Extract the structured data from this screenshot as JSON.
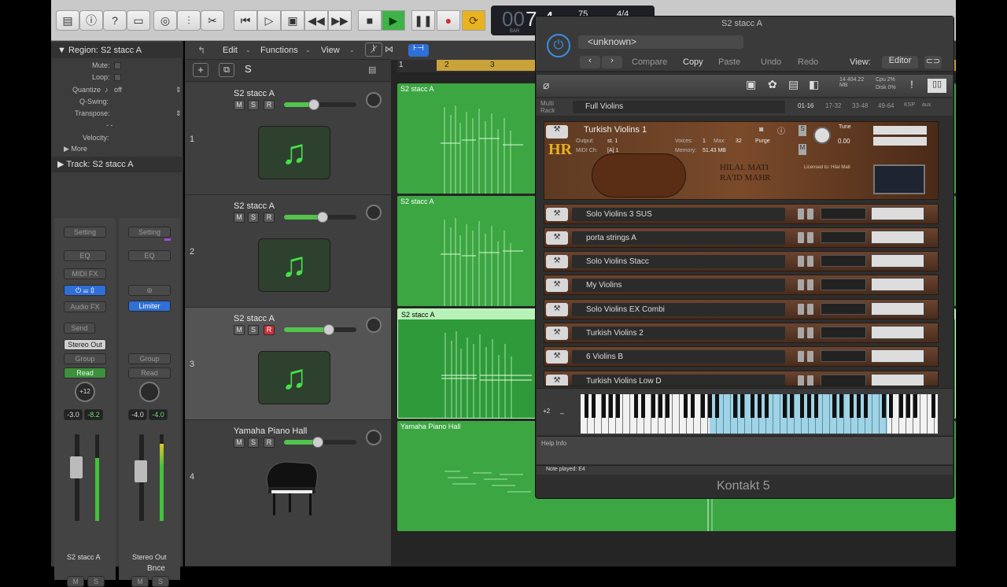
{
  "transport": {
    "lcd_bar": "7",
    "lcd_beat": "4",
    "lcd_tempo": "75",
    "lcd_sig": "4/4",
    "lcd_small": "BAR"
  },
  "inspector": {
    "region_label": "Region:",
    "region_name": "S2 stacc A",
    "mute": "Mute:",
    "loop": "Loop:",
    "quantize": "Quantize",
    "quantize_val": "off",
    "qswing": "Q-Swing:",
    "transpose": "Transpose:",
    "velocity": "Velocity:",
    "more": "More",
    "track_label": "Track:",
    "track_name": "S2 stacc A"
  },
  "strip1": {
    "setting": "Setting",
    "eq": "EQ",
    "midifx": "MIDI FX",
    "audiofx": "Audio FX",
    "send": "Send",
    "output": "Stereo Out",
    "group": "Group",
    "auto": "Read",
    "pan": "+12",
    "val_a": "-3.0",
    "val_b": "-8.2",
    "m": "M",
    "s": "S",
    "name": "S2 stacc A"
  },
  "strip2": {
    "setting": "Setting",
    "eq": "EQ",
    "insert": "Limiter",
    "group": "Group",
    "auto": "Read",
    "val_a": "-4.0",
    "val_b": "-4.0",
    "bnce": "Bnce",
    "m": "M",
    "s": "S",
    "name": "Stereo Out"
  },
  "menu": {
    "edit": "Edit",
    "functions": "Functions",
    "view": "View"
  },
  "tracks": [
    {
      "num": "1",
      "name": "S2 stacc A",
      "m": "M",
      "s": "S",
      "r": "R"
    },
    {
      "num": "2",
      "name": "S2 stacc A",
      "m": "M",
      "s": "S",
      "r": "R"
    },
    {
      "num": "3",
      "name": "S2 stacc A",
      "m": "M",
      "s": "S",
      "r": "R"
    },
    {
      "num": "4",
      "name": "Yamaha Piano Hall",
      "m": "M",
      "s": "S",
      "r": "R"
    }
  ],
  "regions": [
    "S2 stacc A",
    "S2 stacc A",
    "S2 stacc A",
    "Yamaha Piano Hall"
  ],
  "ruler": [
    "1",
    "2",
    "3"
  ],
  "kontakt": {
    "title": "S2 stacc A",
    "preset": "<unknown>",
    "compare": "Compare",
    "copy": "Copy",
    "paste": "Paste",
    "undo": "Undo",
    "redo": "Redo",
    "view": "View:",
    "editor": "Editor",
    "multi": "Multi Rack",
    "rack_name": "Full Violins",
    "pages": [
      "01-16",
      "17-32",
      "33-48",
      "49-64",
      "KSP",
      "aux"
    ],
    "mem": "14 404.22 MB",
    "cpu": "Cpu 2%",
    "disk": "Disk 0%",
    "inst1": {
      "name": "Turkish Violins 1",
      "output": "Output:",
      "output_val": "st. 1",
      "voices": "Voices:",
      "voices_val": "1",
      "max": "Max:",
      "max_val": "32",
      "purge": "Purge",
      "midi": "MIDI Ch:",
      "midi_val": "[A] 1",
      "memory": "Memory:",
      "memory_val": "51.43 MB",
      "tune": "Tune",
      "tune_val": "0.00",
      "banner1": "HILAL MATI",
      "banner2": "RA'ID MAHR",
      "licensed": "Licensed to: Hilal Mati"
    },
    "instruments": [
      "Solo Violins 3 SUS",
      "porta strings A",
      "Solo Violins Stacc",
      "My Violins",
      "Solo Violins EX Combi",
      "Turkish Violins 2",
      "6 Violins B",
      "Turkish Violins Low D"
    ],
    "oct": "+2",
    "help": "Help Info",
    "status": "Note played: E4",
    "brand": "Kontakt 5"
  }
}
